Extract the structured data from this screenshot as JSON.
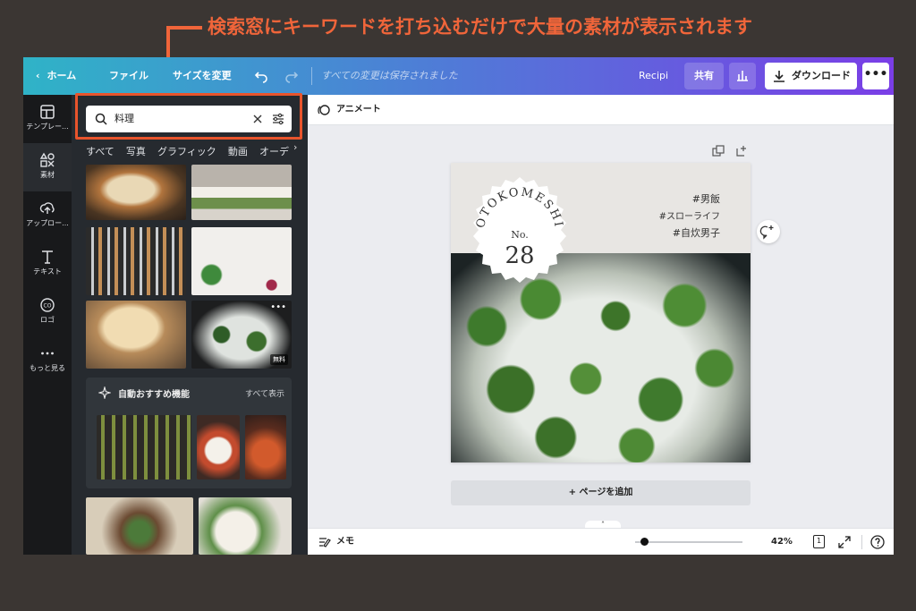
{
  "annotation": {
    "caption": "検索窓にキーワードを打ち込むだけで大量の素材が表示されます",
    "color": "#f0653a"
  },
  "topbar": {
    "home_label": "ホーム",
    "file_label": "ファイル",
    "resize_label": "サイズを変更",
    "saved_status": "すべての変更は保存されました",
    "design_name": "Recipi",
    "share_label": "共有",
    "download_label": "ダウンロード",
    "more_label": "•••"
  },
  "rail": {
    "items": [
      {
        "label": "テンプレー...",
        "icon": "template-icon"
      },
      {
        "label": "素材",
        "icon": "elements-icon"
      },
      {
        "label": "アップロー...",
        "icon": "upload-icon"
      },
      {
        "label": "テキスト",
        "icon": "text-icon"
      },
      {
        "label": "ロゴ",
        "icon": "logo-icon"
      },
      {
        "label": "もっと見る",
        "icon": "more-icon"
      }
    ]
  },
  "panel": {
    "search": {
      "value": "料理"
    },
    "tabs": [
      "すべて",
      "写真",
      "グラフィック",
      "動画",
      "オーデ"
    ],
    "active_tab": "写真",
    "free_badge": "無料",
    "recommend": {
      "title": "自動おすすめ機能",
      "see_all": "すべて表示"
    }
  },
  "editor": {
    "animate_label": "アニメート",
    "canvas": {
      "stamp_arc": "OTOKOMESHI",
      "stamp_no": "No.",
      "stamp_number": "28",
      "hashtags": [
        "#男飯",
        "#スローライフ",
        "#自炊男子"
      ]
    },
    "add_page_label": "+ ページを追加"
  },
  "bottombar": {
    "notes_label": "メモ",
    "zoom_level": "42%",
    "zoom_fraction": 0.08,
    "page_count": "1"
  }
}
